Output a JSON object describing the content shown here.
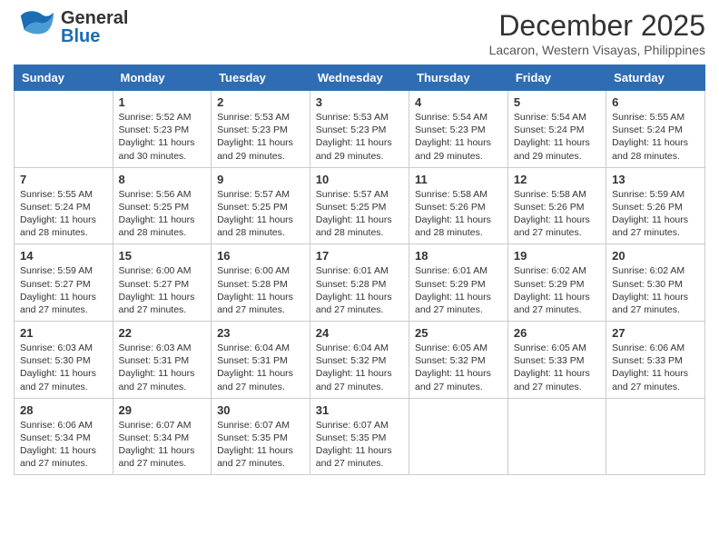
{
  "header": {
    "logo_general": "General",
    "logo_blue": "Blue",
    "month": "December 2025",
    "location": "Lacaron, Western Visayas, Philippines"
  },
  "weekdays": [
    "Sunday",
    "Monday",
    "Tuesday",
    "Wednesday",
    "Thursday",
    "Friday",
    "Saturday"
  ],
  "weeks": [
    [
      {
        "day": "",
        "info": ""
      },
      {
        "day": "1",
        "info": "Sunrise: 5:52 AM\nSunset: 5:23 PM\nDaylight: 11 hours\nand 30 minutes."
      },
      {
        "day": "2",
        "info": "Sunrise: 5:53 AM\nSunset: 5:23 PM\nDaylight: 11 hours\nand 29 minutes."
      },
      {
        "day": "3",
        "info": "Sunrise: 5:53 AM\nSunset: 5:23 PM\nDaylight: 11 hours\nand 29 minutes."
      },
      {
        "day": "4",
        "info": "Sunrise: 5:54 AM\nSunset: 5:23 PM\nDaylight: 11 hours\nand 29 minutes."
      },
      {
        "day": "5",
        "info": "Sunrise: 5:54 AM\nSunset: 5:24 PM\nDaylight: 11 hours\nand 29 minutes."
      },
      {
        "day": "6",
        "info": "Sunrise: 5:55 AM\nSunset: 5:24 PM\nDaylight: 11 hours\nand 28 minutes."
      }
    ],
    [
      {
        "day": "7",
        "info": "Sunrise: 5:55 AM\nSunset: 5:24 PM\nDaylight: 11 hours\nand 28 minutes."
      },
      {
        "day": "8",
        "info": "Sunrise: 5:56 AM\nSunset: 5:25 PM\nDaylight: 11 hours\nand 28 minutes."
      },
      {
        "day": "9",
        "info": "Sunrise: 5:57 AM\nSunset: 5:25 PM\nDaylight: 11 hours\nand 28 minutes."
      },
      {
        "day": "10",
        "info": "Sunrise: 5:57 AM\nSunset: 5:25 PM\nDaylight: 11 hours\nand 28 minutes."
      },
      {
        "day": "11",
        "info": "Sunrise: 5:58 AM\nSunset: 5:26 PM\nDaylight: 11 hours\nand 28 minutes."
      },
      {
        "day": "12",
        "info": "Sunrise: 5:58 AM\nSunset: 5:26 PM\nDaylight: 11 hours\nand 27 minutes."
      },
      {
        "day": "13",
        "info": "Sunrise: 5:59 AM\nSunset: 5:26 PM\nDaylight: 11 hours\nand 27 minutes."
      }
    ],
    [
      {
        "day": "14",
        "info": "Sunrise: 5:59 AM\nSunset: 5:27 PM\nDaylight: 11 hours\nand 27 minutes."
      },
      {
        "day": "15",
        "info": "Sunrise: 6:00 AM\nSunset: 5:27 PM\nDaylight: 11 hours\nand 27 minutes."
      },
      {
        "day": "16",
        "info": "Sunrise: 6:00 AM\nSunset: 5:28 PM\nDaylight: 11 hours\nand 27 minutes."
      },
      {
        "day": "17",
        "info": "Sunrise: 6:01 AM\nSunset: 5:28 PM\nDaylight: 11 hours\nand 27 minutes."
      },
      {
        "day": "18",
        "info": "Sunrise: 6:01 AM\nSunset: 5:29 PM\nDaylight: 11 hours\nand 27 minutes."
      },
      {
        "day": "19",
        "info": "Sunrise: 6:02 AM\nSunset: 5:29 PM\nDaylight: 11 hours\nand 27 minutes."
      },
      {
        "day": "20",
        "info": "Sunrise: 6:02 AM\nSunset: 5:30 PM\nDaylight: 11 hours\nand 27 minutes."
      }
    ],
    [
      {
        "day": "21",
        "info": "Sunrise: 6:03 AM\nSunset: 5:30 PM\nDaylight: 11 hours\nand 27 minutes."
      },
      {
        "day": "22",
        "info": "Sunrise: 6:03 AM\nSunset: 5:31 PM\nDaylight: 11 hours\nand 27 minutes."
      },
      {
        "day": "23",
        "info": "Sunrise: 6:04 AM\nSunset: 5:31 PM\nDaylight: 11 hours\nand 27 minutes."
      },
      {
        "day": "24",
        "info": "Sunrise: 6:04 AM\nSunset: 5:32 PM\nDaylight: 11 hours\nand 27 minutes."
      },
      {
        "day": "25",
        "info": "Sunrise: 6:05 AM\nSunset: 5:32 PM\nDaylight: 11 hours\nand 27 minutes."
      },
      {
        "day": "26",
        "info": "Sunrise: 6:05 AM\nSunset: 5:33 PM\nDaylight: 11 hours\nand 27 minutes."
      },
      {
        "day": "27",
        "info": "Sunrise: 6:06 AM\nSunset: 5:33 PM\nDaylight: 11 hours\nand 27 minutes."
      }
    ],
    [
      {
        "day": "28",
        "info": "Sunrise: 6:06 AM\nSunset: 5:34 PM\nDaylight: 11 hours\nand 27 minutes."
      },
      {
        "day": "29",
        "info": "Sunrise: 6:07 AM\nSunset: 5:34 PM\nDaylight: 11 hours\nand 27 minutes."
      },
      {
        "day": "30",
        "info": "Sunrise: 6:07 AM\nSunset: 5:35 PM\nDaylight: 11 hours\nand 27 minutes."
      },
      {
        "day": "31",
        "info": "Sunrise: 6:07 AM\nSunset: 5:35 PM\nDaylight: 11 hours\nand 27 minutes."
      },
      {
        "day": "",
        "info": ""
      },
      {
        "day": "",
        "info": ""
      },
      {
        "day": "",
        "info": ""
      }
    ]
  ]
}
